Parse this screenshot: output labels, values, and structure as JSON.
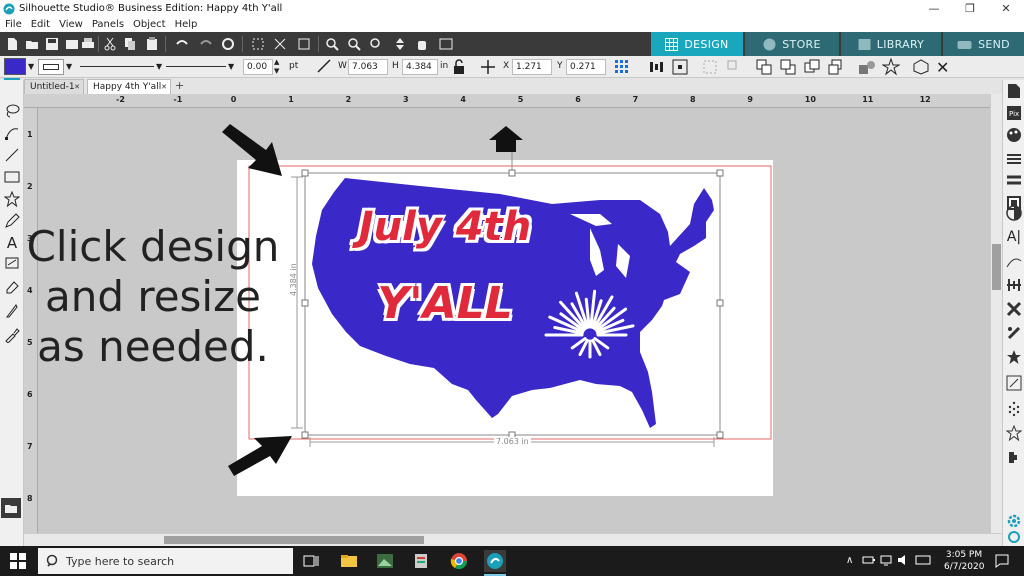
{
  "window": {
    "title": "Silhouette Studio® Business Edition: Happy 4th Y'all",
    "minimize": "—",
    "restore": "❐",
    "close": "✕"
  },
  "menu": [
    "File",
    "Edit",
    "View",
    "Panels",
    "Object",
    "Help"
  ],
  "nav_tabs": [
    {
      "label": "DESIGN",
      "active": true
    },
    {
      "label": "STORE",
      "active": false
    },
    {
      "label": "LIBRARY",
      "active": false
    },
    {
      "label": "SEND",
      "active": false
    }
  ],
  "toolbar2": {
    "line_width_value": "0.00",
    "line_width_unit": "pt",
    "w_label": "W",
    "w_value": "7.063",
    "h_label": "H",
    "h_value": "4.384",
    "size_unit": "in",
    "x_label": "X",
    "x_value": "1.271",
    "y_label": "Y",
    "y_value": "0.271",
    "fill_color": "#3a28c8"
  },
  "doc_tabs": [
    {
      "label": "Untitled-1",
      "active": false
    },
    {
      "label": "Happy 4th Y'all",
      "active": true
    }
  ],
  "hruler_labels": [
    "-2",
    "-1",
    "0",
    "1",
    "2",
    "3",
    "4",
    "5",
    "6",
    "7",
    "8",
    "9",
    "10",
    "11",
    "12"
  ],
  "vruler_labels": [
    "1",
    "2",
    "3",
    "4",
    "5",
    "6",
    "7",
    "8"
  ],
  "selection": {
    "width_label": "7.063 in",
    "height_label": "4.384 in"
  },
  "design": {
    "line1": "July 4th",
    "line2": "Y'ALL",
    "map_color": "#3a28c8",
    "text_color": "#e0293a"
  },
  "instruction": [
    "Click design",
    "and resize",
    "as needed."
  ],
  "taskbar": {
    "search_placeholder": "Type here to search",
    "time": "3:05 PM",
    "date": "6/7/2020"
  },
  "colors": {
    "accent_tab": "#18a7bd",
    "toolbar_dark": "#3a3a3a"
  }
}
